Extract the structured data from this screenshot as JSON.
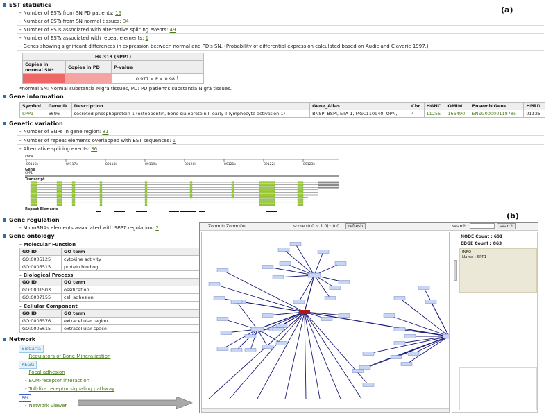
{
  "panel_labels": {
    "a": "(a)",
    "b": "(b)"
  },
  "est": {
    "title": "EST statistics",
    "items": [
      {
        "text": "Number of ESTs from SN PD patients: ",
        "value": "19"
      },
      {
        "text": "Number of ESTs from SN normal tissues: ",
        "value": "34"
      },
      {
        "text": "Number of ESTs associated with alternative splicing events: ",
        "value": "49"
      },
      {
        "text": "Number of ESTs associated with repeat elements: ",
        "value": "1"
      }
    ],
    "significance": "Genes showing significant differences in expression between normal and PD's SN. (Probability of differential expression calculated based on Audic and Claverie 1997.)"
  },
  "expr_table": {
    "header": "Hs.313 (SPP1)",
    "col1": "Copies in normal SN*",
    "col2": "Copies in PD",
    "col3": "P-value",
    "pvalue": "0.977 < P < 0.98",
    "mark": "!",
    "color_normal": "#f06767",
    "color_pd": "#f5a3a3",
    "footnote": "*normal SN: Normal substantia Nigra tissues, PD: PD patient's substantia Nigra tissues."
  },
  "gene_info": {
    "title": "Gene information",
    "headers": [
      "Symbol",
      "GeneID",
      "Description",
      "Gene_Alias",
      "Chr",
      "HGNC",
      "OMIM",
      "EnsemblGene",
      "HPRD"
    ],
    "row": [
      "SPP1",
      "6696",
      "secreted phosphoprotein 1 (osteopontin, bone sialoprotein I, early T-lymphocyte activation 1)",
      "BNSP, BSPI, ETA-1, MGC110940, OPN,",
      "4",
      "11255",
      "166490",
      "ENSG00000118785",
      "01325"
    ]
  },
  "genetic": {
    "title": "Genetic variation",
    "items": [
      {
        "text": "Number of SNPs in gene region: ",
        "value": "81"
      },
      {
        "text": "Number of repeat elements overlapped with EST sequences: ",
        "value": "1"
      },
      {
        "text": "Alternative splicing events: ",
        "value": "36"
      }
    ],
    "track": {
      "chr_label": "chr4",
      "ticks": [
        "89116k",
        "89117k",
        "89118k",
        "89119k",
        "89120k",
        "89121k",
        "89122k",
        "89123k"
      ],
      "gene_label": "Gene",
      "gene_name": "SPP1",
      "transcript_label": "Transcript",
      "repeat_label": "Repeat Elements",
      "exon_color": "#9ccc3c"
    }
  },
  "regulation": {
    "title": "Gene regulation",
    "text_prefix": "MicroRNAs elements associated with ",
    "gene": "SPP1",
    "text_suffix": " regulation: ",
    "value": "2"
  },
  "ontology": {
    "title": "Gene ontology",
    "molecular": {
      "title": "Molecular Function",
      "headers": [
        "GO ID",
        "GO term"
      ],
      "rows": [
        [
          "GO:0005125",
          "cytokine activity"
        ],
        [
          "GO:0005515",
          "protein binding"
        ]
      ]
    },
    "biological": {
      "title": "Biological Process",
      "headers": [
        "GO ID",
        "GO term"
      ],
      "rows": [
        [
          "GO:0001503",
          "ossification"
        ],
        [
          "GO:0007155",
          "cell adhesion"
        ]
      ]
    },
    "cellular": {
      "title": "Cellular Component",
      "headers": [
        "GO ID",
        "GO term"
      ],
      "rows": [
        [
          "GO:0005576",
          "extracellular region"
        ],
        [
          "GO:0005615",
          "extracellular space"
        ]
      ]
    }
  },
  "network": {
    "title": "Network",
    "biocarta": "BioCarta",
    "biocarta_items": [
      "Regulators of Bone Mineralization"
    ],
    "kegg": "KEGG",
    "kegg_items": [
      "Focal adhesion",
      "ECM-receptor interaction",
      "Toll-like receptor signaling pathway"
    ],
    "ppi": "PPI",
    "ppi_items": [
      "Network viewer"
    ]
  },
  "viewer": {
    "zoom_in": "Zoom In",
    "zoom_out": "Zoom Out",
    "score_label": "score (0.0 ~ 1.0) : 0.0",
    "refresh": "refresh",
    "search_label": "search :",
    "search_button": "search",
    "node_count": "NODE Count : 691",
    "edge_count": "EDGE Count : 863",
    "info": "INFO",
    "info_name": "Name : SPP1",
    "edge_color": "#1a1a7a",
    "node_color": "#c8d6f5",
    "hub_color": "#b01818"
  }
}
